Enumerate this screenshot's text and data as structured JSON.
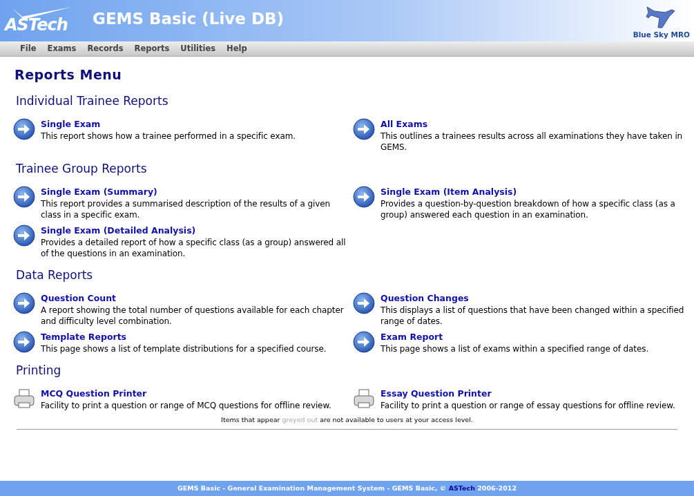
{
  "header": {
    "logo": "ASTech",
    "title": "GEMS Basic (Live DB)",
    "client": "Blue Sky MRO"
  },
  "menu": [
    "File",
    "Exams",
    "Records",
    "Reports",
    "Utilities",
    "Help"
  ],
  "page_title": "Reports Menu",
  "sections": [
    {
      "heading": "Individual Trainee Reports",
      "items": [
        {
          "kind": "arrow",
          "title": "Single Exam",
          "description": "This report shows how a trainee performed in a specific exam."
        },
        {
          "kind": "arrow",
          "title": "All Exams",
          "description": "This outlines a trainees results across all examinations they have taken in GEMS."
        }
      ]
    },
    {
      "heading": "Trainee Group Reports",
      "items": [
        {
          "kind": "arrow",
          "title": "Single Exam (Summary)",
          "description": "This report provides a summarised description of the results of a given class in a specific exam."
        },
        {
          "kind": "arrow",
          "title": "Single Exam (Item Analysis)",
          "description": "Provides a question-by-question breakdown of how a specific class (as a group) answered each question in an examination."
        },
        {
          "kind": "arrow",
          "title": "Single Exam (Detailed Analysis)",
          "description": "Provides a detailed report of how a specific class (as a group) answered all of the questions in an examination."
        }
      ]
    },
    {
      "heading": "Data Reports",
      "items": [
        {
          "kind": "arrow",
          "title": "Question Count",
          "description": "A report showing the total number of questions available for each chapter and difficulty level combination."
        },
        {
          "kind": "arrow",
          "title": "Question Changes",
          "description": "This displays a list of questions that have been changed within a specified range of dates."
        },
        {
          "kind": "arrow",
          "title": "Template Reports",
          "description": "This page shows a list of template distributions for a specified course."
        },
        {
          "kind": "arrow",
          "title": "Exam Report",
          "description": "This page shows a list of exams within a specified range of dates."
        }
      ]
    },
    {
      "heading": "Printing",
      "items": [
        {
          "kind": "printer",
          "title": "MCQ Question Printer",
          "description": "Facility to print a question or range of MCQ questions for offline review."
        },
        {
          "kind": "printer",
          "title": "Essay Question Printer",
          "description": "Facility to print a question or range of essay questions for offline review."
        }
      ]
    }
  ],
  "note": {
    "before": "Items that appear",
    "greyed": "greyed out",
    "after": "are not available to users at your access level."
  },
  "footer": {
    "before": "GEMS Basic - General Examination Management System - GEMS Basic, ©",
    "link": "ASTech",
    "after": "2006-2012"
  }
}
